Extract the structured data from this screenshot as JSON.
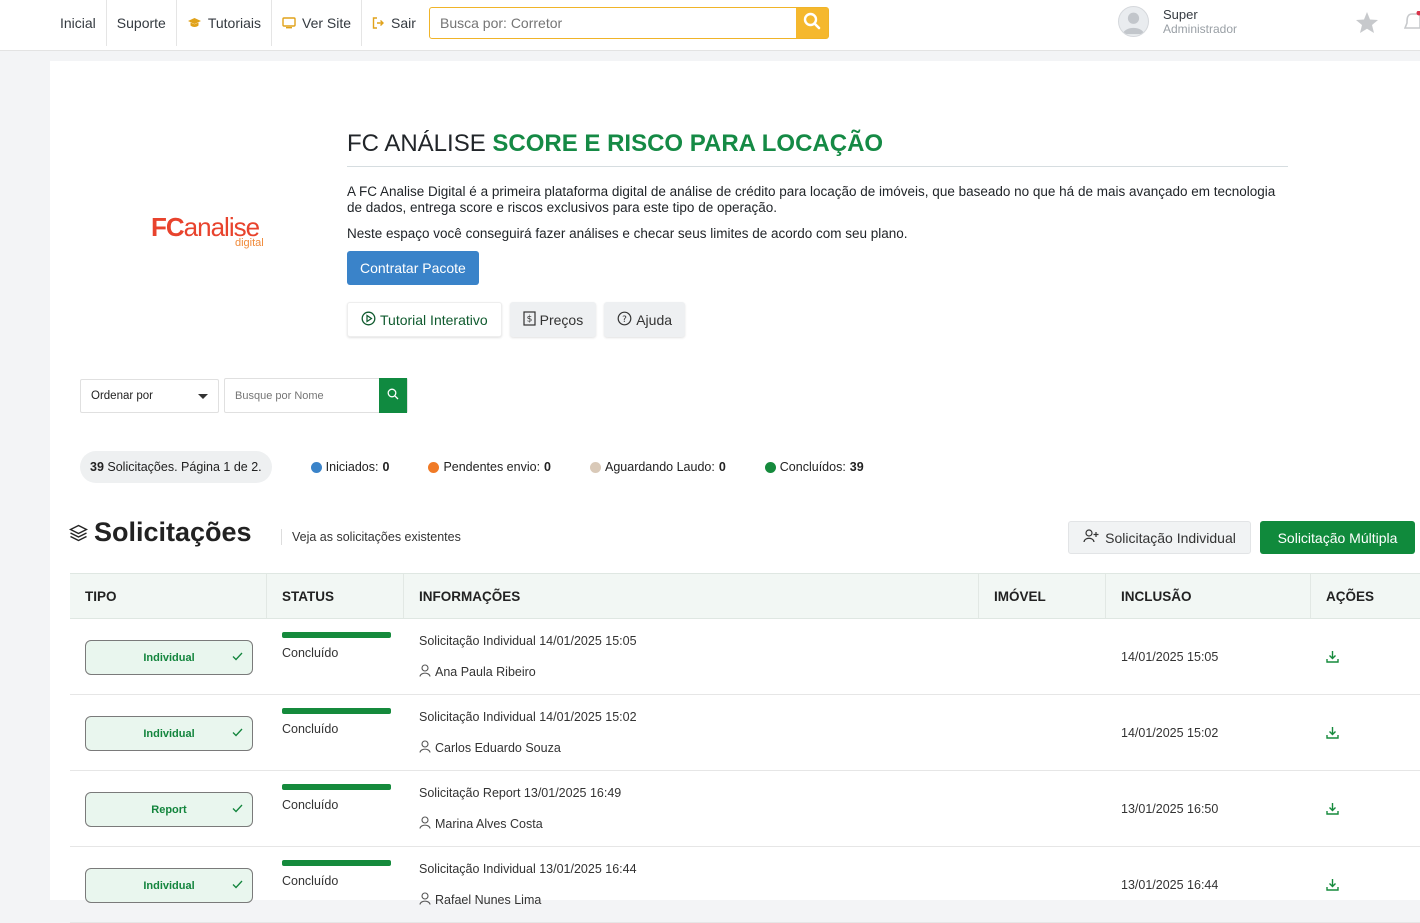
{
  "topbar": {
    "nav": [
      {
        "label": "Inicial",
        "icon": ""
      },
      {
        "label": "Suporte",
        "icon": ""
      },
      {
        "label": "Tutoriais",
        "icon": "graduation-cap-icon"
      },
      {
        "label": "Ver Site",
        "icon": "monitor-icon"
      },
      {
        "label": "Sair",
        "icon": "sign-out-icon"
      }
    ],
    "search_placeholder": "Busca por: Corretor",
    "user_name": "Super",
    "user_role": "Administrador"
  },
  "hero": {
    "title_plain": "FC ANÁLISE",
    "title_accent": "SCORE E RISCO PARA LOCAÇÃO",
    "paragraph1": "A FC Analise Digital é a primeira plataforma digital de análise de crédito para locação de imóveis, que baseado no que há de mais avançado em tecnologia de dados, entrega score e riscos exclusivos para este tipo de operação.",
    "paragraph2": "Neste espaço você conseguirá fazer análises e checar seus limites de acordo com seu plano.",
    "contract_button": "Contratar Pacote",
    "pills": [
      "Tutorial Interativo",
      "Preços",
      "Ajuda"
    ]
  },
  "logo": {
    "fc": "FC",
    "analise": "analise",
    "digital": "digital"
  },
  "filters": {
    "sort_label": "Ordenar por",
    "name_search_placeholder": "Busque por Nome"
  },
  "summary": {
    "count_number": "39",
    "count_text": "Solicitações. Página 1 de 2.",
    "stats": [
      {
        "label": "Iniciados:",
        "value": "0",
        "color": "#3a83c9"
      },
      {
        "label": "Pendentes envio:",
        "value": "0",
        "color": "#f07a26"
      },
      {
        "label": "Aguardando Laudo:",
        "value": "0",
        "color": "#d9c9b8"
      },
      {
        "label": "Concluídos:",
        "value": "39",
        "color": "#158a3c"
      }
    ]
  },
  "section": {
    "title": "Solicitações",
    "subtitle": "Veja as solicitações existentes",
    "btn_individual": "Solicitação Individual",
    "btn_multiple": "Solicitação Múltipla"
  },
  "table": {
    "headers": [
      "TIPO",
      "STATUS",
      "INFORMAÇÕES",
      "IMÓVEL",
      "INCLUSÃO",
      "AÇÕES"
    ],
    "rows": [
      {
        "tipo": "Individual",
        "status": "Concluído",
        "progress": 1.0,
        "info": "Solicitação Individual 14/01/2025 15:05",
        "person": "Ana Paula Ribeiro",
        "imovel": "",
        "inclusao": "14/01/2025 15:05"
      },
      {
        "tipo": "Individual",
        "status": "Concluído",
        "progress": 1.0,
        "info": "Solicitação Individual 14/01/2025 15:02",
        "person": "Carlos Eduardo Souza",
        "imovel": "",
        "inclusao": "14/01/2025 15:02"
      },
      {
        "tipo": "Report",
        "status": "Concluído",
        "progress": 1.0,
        "info": "Solicitação Report 13/01/2025 16:49",
        "person": "Marina Alves Costa",
        "imovel": "",
        "inclusao": "13/01/2025 16:50"
      },
      {
        "tipo": "Individual",
        "status": "Concluído",
        "progress": 1.0,
        "info": "Solicitação Individual 13/01/2025 16:44",
        "person": "Rafael Nunes Lima",
        "imovel": "",
        "inclusao": "13/01/2025 16:44"
      }
    ]
  }
}
